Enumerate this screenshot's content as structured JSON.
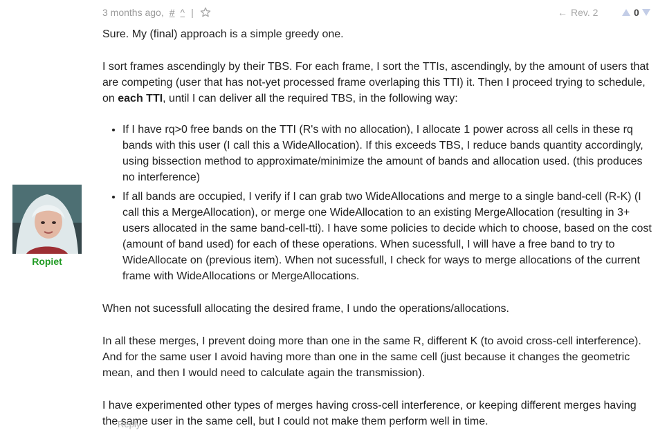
{
  "meta": {
    "time": "3 months ago,",
    "permalink": "#",
    "parent_link": "^",
    "separator": "|"
  },
  "revision": {
    "arrow": "←",
    "label": "Rev. 2"
  },
  "vote": {
    "score": "0"
  },
  "author": {
    "name": "Ropiet"
  },
  "body": {
    "p1": "Sure. My (final) approach is a simple greedy one.",
    "p2_text": "I sort frames ascendingly by their TBS. For each frame, I sort the TTIs, ascendingly, by the amount of users that are competing (user that has not-yet processed frame overlaping this TTI) it. Then I proceed trying to schedule, on ",
    "p2_bold": "each TTI",
    "p2_tail": ", until I can deliver all the required TBS, in the following way:",
    "bullet1": "If I have rq>0 free bands on the TTI (R's with no allocation), I allocate 1 power across all cells in these rq bands with this user (I call this a WideAllocation). If this exceeds TBS, I reduce bands quantity accordingly, using bissection method to approximate/minimize the amount of bands and allocation used. (this produces no interference)",
    "bullet2": "If all bands are occupied, I verify if I can grab two WideAllocations and merge to a single band-cell (R-K) (I call this a MergeAllocation), or merge one WideAllocation to an existing MergeAllocation (resulting in 3+ users allocated in the same band-cell-tti). I have some policies to decide which to choose, based on the cost (amount of band used) for each of these operations. When sucessfull, I will have a free band to try to WideAllocate on (previous item). When not sucessfull, I check for ways to merge allocations of the current frame with WideAllocations or MergeAllocations.",
    "p3": "When not sucessfull allocating the desired frame, I undo the operations/allocations.",
    "p4": "In all these merges, I prevent doing more than one in the same R, different K (to avoid cross-cell interference). And for the same user I avoid having more than one in the same cell (just because it changes the geometric mean, and then I would need to calculate again the transmission).",
    "p5": "I have experimented other types of merges having cross-cell interference, or keeping different merges having the same user in the same cell, but I could not make them perform well in time."
  },
  "reply_label": "Reply"
}
